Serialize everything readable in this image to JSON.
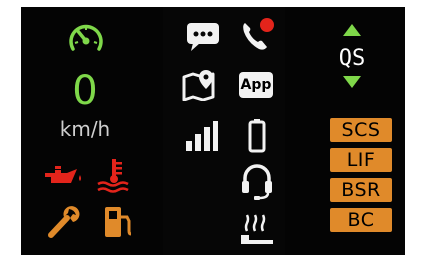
{
  "dashboard": {
    "speed": {
      "value": "0",
      "unit": "km/h"
    },
    "icons": {
      "speedometer": "speedometer-icon",
      "oil": "oil-pressure-icon",
      "coolant": "coolant-temperature-icon",
      "service": "wrench-icon",
      "fuel": "fuel-icon",
      "message": "message-icon",
      "phone": "phone-call-icon",
      "map": "map-navigation-icon",
      "signal": "signal-strength-icon",
      "battery": "battery-icon",
      "headset": "headset-icon",
      "seat_heater": "seat-heater-icon"
    },
    "app_label": "App",
    "quickshifter": {
      "label": "QS"
    },
    "badges": [
      "SCS",
      "LIF",
      "BSR",
      "BC"
    ],
    "colors": {
      "green": "#7fd84a",
      "red": "#e3241b",
      "orange": "#e08a2a",
      "white": "#f2f2f2",
      "gray": "#cfcfcf",
      "background": "#040404"
    }
  }
}
